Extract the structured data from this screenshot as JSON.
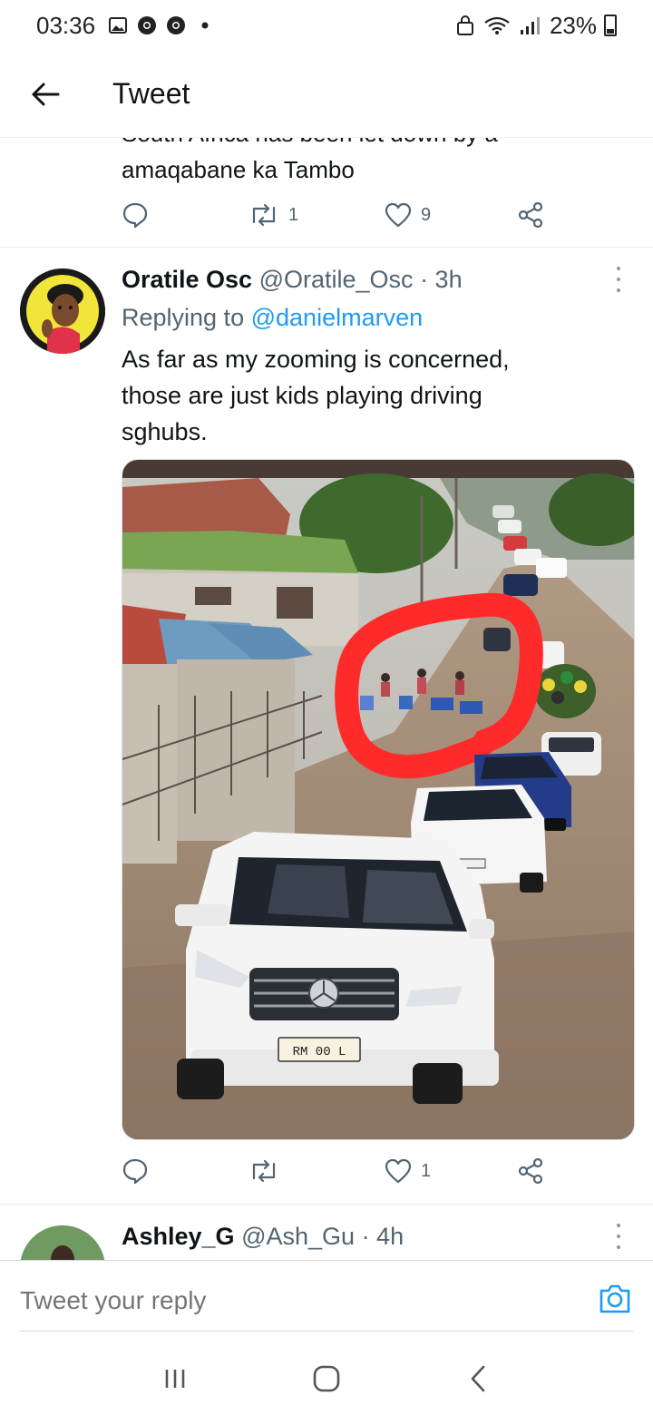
{
  "status_bar": {
    "time": "03:36",
    "battery": "23%",
    "icons": [
      "gallery-icon",
      "chrome-icon",
      "chrome-icon",
      "dot-icon",
      "lock-icon",
      "wifi-icon",
      "signal-icon",
      "battery-icon"
    ]
  },
  "header": {
    "title": "Tweet"
  },
  "prev_tweet": {
    "text_cut": "South Africa has been let down by a",
    "text": "amaqabane ka Tambo",
    "retweets": "1",
    "likes": "9"
  },
  "tweet": {
    "name": "Oratile Osc",
    "handle": "@Oratile_Osc",
    "time": "· 3h",
    "replying_prefix": "Replying to",
    "replying_to": "@danielmarven",
    "text": "As far as my zooming is concerned,\nthose are just kids playing driving\nsghubs.",
    "likes": "1",
    "plate": "RM 00 L"
  },
  "next_tweet": {
    "name": "Ashley_G",
    "handle": "@Ash_Gu",
    "time": "· 4h"
  },
  "reply_bar": {
    "placeholder": "Tweet your reply"
  },
  "colors": {
    "accent": "#1d9bf0",
    "secondary_text": "#536471",
    "circle_annotation": "#ff2a2a"
  }
}
